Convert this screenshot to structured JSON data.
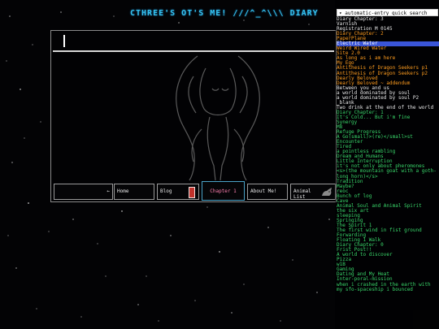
{
  "page": {
    "title": "CTHREE'S OT'S ME! ///^_^\\\\\\ DIARY"
  },
  "search": {
    "placeholder": "automatic-entry quick search"
  },
  "nav": {
    "back_label": "←",
    "home_label": "Home",
    "blog_label": "Blog",
    "chapter_label": "Chapter 1",
    "about_label": "About Me!",
    "animal_label": "Animal List"
  },
  "sidebar": {
    "entries": [
      {
        "label": "Diary Chapter: 3",
        "style": "w"
      },
      {
        "label": "Varnish",
        "style": "w"
      },
      {
        "label": "Registration M 0145",
        "style": "w"
      },
      {
        "label": "Diary Chapter: 2",
        "style": "o"
      },
      {
        "label": "PaperPlane",
        "style": "o"
      },
      {
        "label": "Electric Water",
        "style": "hl"
      },
      {
        "label": "Weird Wired Water",
        "style": "o"
      },
      {
        "label": "Site 2.0",
        "style": "o"
      },
      {
        "label": "As long as i am here",
        "style": "o"
      },
      {
        "label": "My Ego",
        "style": "o"
      },
      {
        "label": "Antithesis of Dragon Seekers p1",
        "style": "o"
      },
      {
        "label": "Antithesis of Dragon Seekers p2",
        "style": "o"
      },
      {
        "label": "Dearly Beloved",
        "style": "o"
      },
      {
        "label": "Dearly Beloved ~ addendum",
        "style": "o"
      },
      {
        "label": "Between you and us",
        "style": "w"
      },
      {
        "label": "a world dominated by soul",
        "style": "w"
      },
      {
        "label": "a world dominated by soul P2",
        "style": "w"
      },
      {
        "label": "_blank",
        "style": "w"
      },
      {
        "label": "Two drink at the end of the world",
        "style": "w"
      },
      {
        "label": "Diary Chapter: 1",
        "style": "g"
      },
      {
        "label": "It's Cold... But i'm fine",
        "style": "g"
      },
      {
        "label": "Synergy",
        "style": "g"
      },
      {
        "label": "M8",
        "style": "g"
      },
      {
        "label": "Refuge Progress",
        "style": "g"
      },
      {
        "label": "A Go(small)>(re)</small>st",
        "style": "g"
      },
      {
        "label": "Encounter",
        "style": "g"
      },
      {
        "label": "Tired",
        "style": "g"
      },
      {
        "label": "a pointless rambling",
        "style": "g"
      },
      {
        "label": "Dream and Humans",
        "style": "g"
      },
      {
        "label": "Little Interruption",
        "style": "g"
      },
      {
        "label": "it's not only about pheromones",
        "style": "g"
      },
      {
        "label": "<s>(the mountain goat with a goth-long horn)</s>",
        "style": "g"
      },
      {
        "label": "Tradition",
        "style": "g"
      },
      {
        "label": "Maybe?",
        "style": "g"
      },
      {
        "label": "reoc",
        "style": "g"
      },
      {
        "label": "Bunch of log",
        "style": "g"
      },
      {
        "label": "Cave",
        "style": "g"
      },
      {
        "label": "Animal Soul and Animal Spirit",
        "style": "g"
      },
      {
        "label": "the six art",
        "style": "g"
      },
      {
        "label": "sleeping",
        "style": "g"
      },
      {
        "label": "Springing",
        "style": "g"
      },
      {
        "label": "The Spirit 1",
        "style": "g"
      },
      {
        "label": "The first wind in fist ground",
        "style": "g"
      },
      {
        "label": "Forwarding",
        "style": "g"
      },
      {
        "label": "Floating 1 Walk",
        "style": "g"
      },
      {
        "label": "Diary Chapter: 0",
        "style": "g"
      },
      {
        "label": "Frist Post!!",
        "style": "g"
      },
      {
        "label": "A world to discover",
        "style": "g"
      },
      {
        "label": "Pizza",
        "style": "g"
      },
      {
        "label": "w1B",
        "style": "g"
      },
      {
        "label": "Gaming",
        "style": "g"
      },
      {
        "label": "Dating and My Heat",
        "style": "g"
      },
      {
        "label": "Inter-poral-mission",
        "style": "g"
      },
      {
        "label": "when i crashed in the earth with",
        "style": "g"
      },
      {
        "label": "my sfo-spaceship i bounced",
        "style": "g"
      }
    ]
  }
}
